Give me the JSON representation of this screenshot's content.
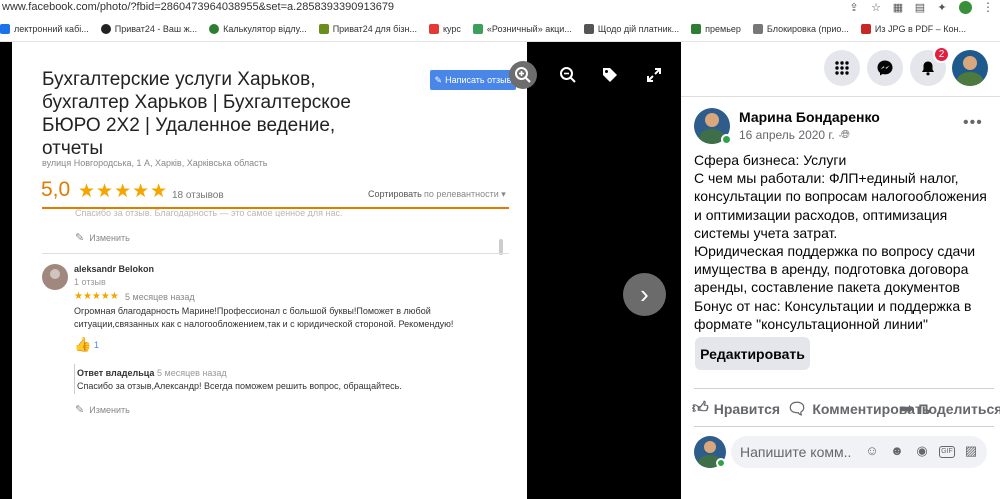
{
  "browser": {
    "url": "www.facebook.com/photo/?fbid=2860473964038955&set=a.2858393390913679",
    "bookmarks": [
      {
        "label": "лектронний кабі...",
        "color": "#1a73e8"
      },
      {
        "label": "Приват24 - Ваш ж...",
        "color": "#222222"
      },
      {
        "label": "Калькулятор відлу...",
        "color": "#2e7d32"
      },
      {
        "label": "Приват24 для бізн...",
        "color": "#6a8f1f"
      },
      {
        "label": "курс",
        "color": "#e53935"
      },
      {
        "label": "«Розничный» акци...",
        "color": "#3aa05a"
      },
      {
        "label": "Щодо дій платник...",
        "color": "#555555"
      },
      {
        "label": "премьер",
        "color": "#2e7d32"
      },
      {
        "label": "Блокировка (прио...",
        "color": "#777777"
      },
      {
        "label": "Из JPG в PDF – Кон...",
        "color": "#c62828"
      }
    ]
  },
  "photo": {
    "business_title": "Бухгалтерские услуги Харьков, бухгалтер Харьков | Бухгалтерское БЮРО 2Х2 | Удаленное ведение, отчеты",
    "write_review_label": "Написать отзыв",
    "address": "вулиця Новгородська, 1 А, Харків, Харківська область",
    "rating": "5,0",
    "rating_stars": "★★★★★",
    "review_count": "18 отзывов",
    "sort_label": "Сортировать",
    "sort_value": "по релевантности",
    "cut_text": "Спасибо за отзыв. Благодарность — это самое ценное для нас.",
    "edit_label": "Изменить",
    "review": {
      "name": "aleksandr Belokon",
      "count": "1 отзыв",
      "stars": "★★★★★",
      "date": "5 месяцев назад",
      "text_line1": "Огромная благодарность Марине!Профессионал с большой буквы!Поможет в любой",
      "text_line2": "ситуации,связанных как с налогообложением,так и с юридической стороной. Рекомендую!",
      "likes": "1"
    },
    "owner_reply": {
      "title": "Ответ владельца",
      "date": "5 месяцев назад",
      "text": "Спасибо за отзыв,Александр! Всегда поможем решить вопрос, обращайтесь."
    }
  },
  "viewer": {
    "icons": [
      "zoom-in-icon",
      "zoom-out-icon",
      "tag-icon",
      "fullscreen-icon",
      "next-arrow-icon"
    ]
  },
  "header": {
    "notification_count": "2"
  },
  "post": {
    "author": "Марина Бондаренко",
    "date": "16 апрель 2020 г. ·",
    "lines": [
      "Сфера бизнеса: Услуги",
      "С чем мы работали: ФЛП+единый налог,",
      "консультации по вопросам налогообложения",
      "и оптимизации расходов, оптимизация",
      "системы учета затрат.",
      "Юридическая поддержка по вопросу сдачи",
      "имущества в аренду, подготовка договора",
      "аренды, составление пакета документов",
      "Бонус от нас: Консультации и поддержка в",
      "формате \"консультационной линии\""
    ],
    "edit_label": "Редактировать",
    "actions": {
      "like": "Нравится",
      "comment": "Комментировать",
      "share": "Поделиться"
    },
    "comment_placeholder": "Напишите комм..."
  },
  "colors": {
    "accent_blue": "#4a85e8",
    "rating_orange": "#e07b00",
    "star_yellow": "#f4a500",
    "online_green": "#31a24c",
    "badge_red": "#e41e3f"
  }
}
